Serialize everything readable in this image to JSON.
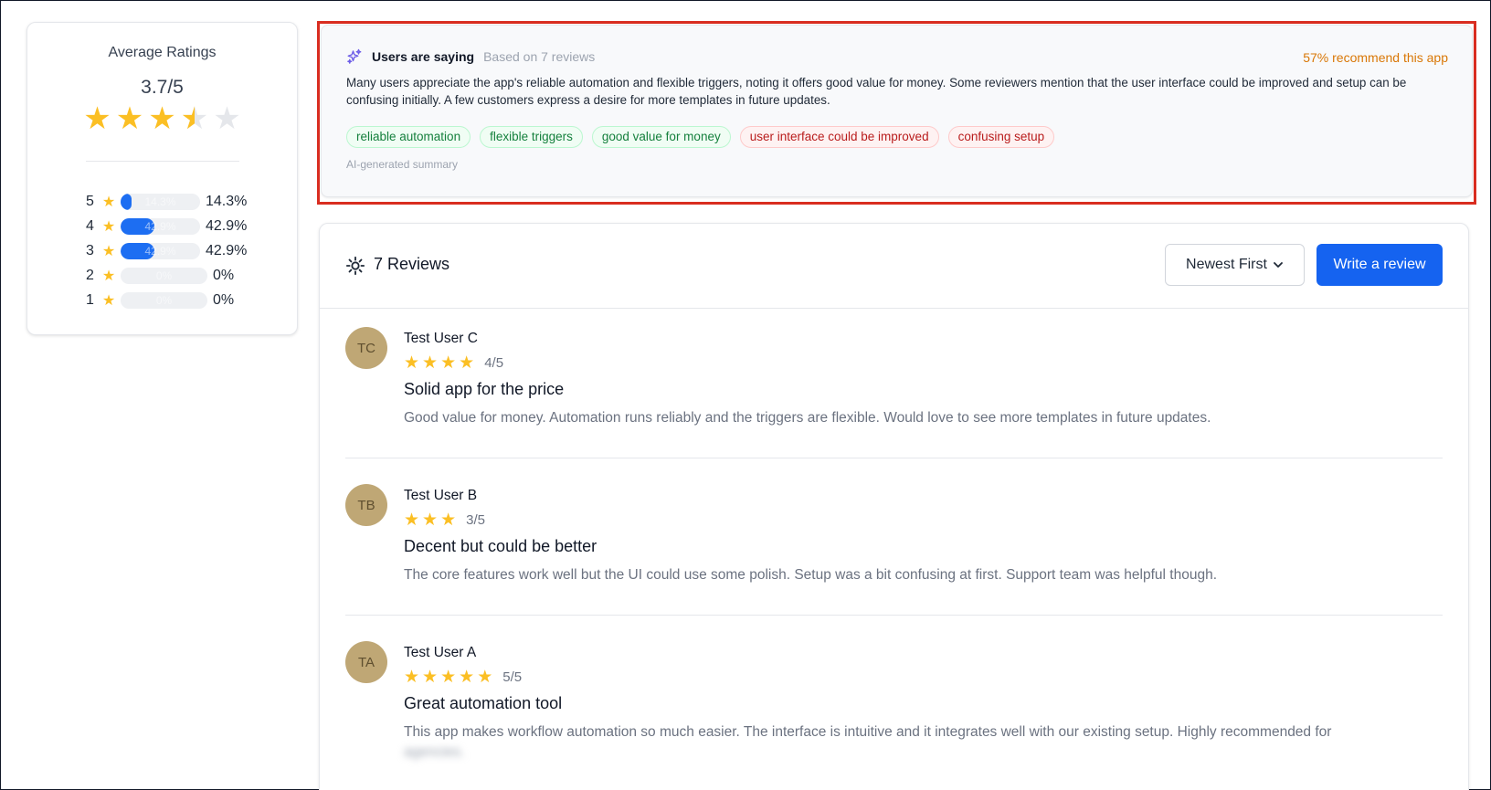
{
  "ratings": {
    "title": "Average Ratings",
    "average": "3.7/5",
    "average_value": 3.7,
    "star_color": "#fbbf24",
    "distribution": [
      {
        "stars": "5",
        "bar_label": "14.3%",
        "pct_label": "14.3%",
        "fraction": 0.143
      },
      {
        "stars": "4",
        "bar_label": "42.9%",
        "pct_label": "42.9%",
        "fraction": 0.429
      },
      {
        "stars": "3",
        "bar_label": "42.9%",
        "pct_label": "42.9%",
        "fraction": 0.429
      },
      {
        "stars": "2",
        "bar_label": "0%",
        "pct_label": "0%",
        "fraction": 0
      },
      {
        "stars": "1",
        "bar_label": "0%",
        "pct_label": "0%",
        "fraction": 0
      }
    ]
  },
  "summary": {
    "title": "Users are saying",
    "based_on": "Based on 7 reviews",
    "recommend": "57% recommend this app",
    "text": "Many users appreciate the app's reliable automation and flexible triggers, noting it offers good value for money. Some reviewers mention that the user interface could be improved and setup can be confusing initially. A few customers express a desire for more templates in future updates.",
    "tags": [
      {
        "label": "reliable automation",
        "sentiment": "positive"
      },
      {
        "label": "flexible triggers",
        "sentiment": "positive"
      },
      {
        "label": "good value for money",
        "sentiment": "positive"
      },
      {
        "label": "user interface could be improved",
        "sentiment": "negative"
      },
      {
        "label": "confusing setup",
        "sentiment": "negative"
      }
    ],
    "footer": "AI-generated summary",
    "highlight_color": "#d92d20"
  },
  "reviews": {
    "count_label": "7 Reviews",
    "sort_label": "Newest First",
    "write_label": "Write a review",
    "accent": "#1563f0",
    "items": [
      {
        "initials": "TC",
        "name": "Test User C",
        "stars": 4,
        "score": "4/5",
        "title": "Solid app for the price",
        "body": "Good value for money. Automation runs reliably and the triggers are flexible. Would love to see more templates in future updates."
      },
      {
        "initials": "TB",
        "name": "Test User B",
        "stars": 3,
        "score": "3/5",
        "title": "Decent but could be better",
        "body": "The core features work well but the UI could use some polish. Setup was a bit confusing at first. Support team was helpful though."
      },
      {
        "initials": "TA",
        "name": "Test User A",
        "stars": 5,
        "score": "5/5",
        "title": "Great automation tool",
        "body": "This app makes workflow automation so much easier. The interface is intuitive and it integrates well with our existing setup. Highly recommended for",
        "body_blurred": "agencies."
      }
    ]
  }
}
